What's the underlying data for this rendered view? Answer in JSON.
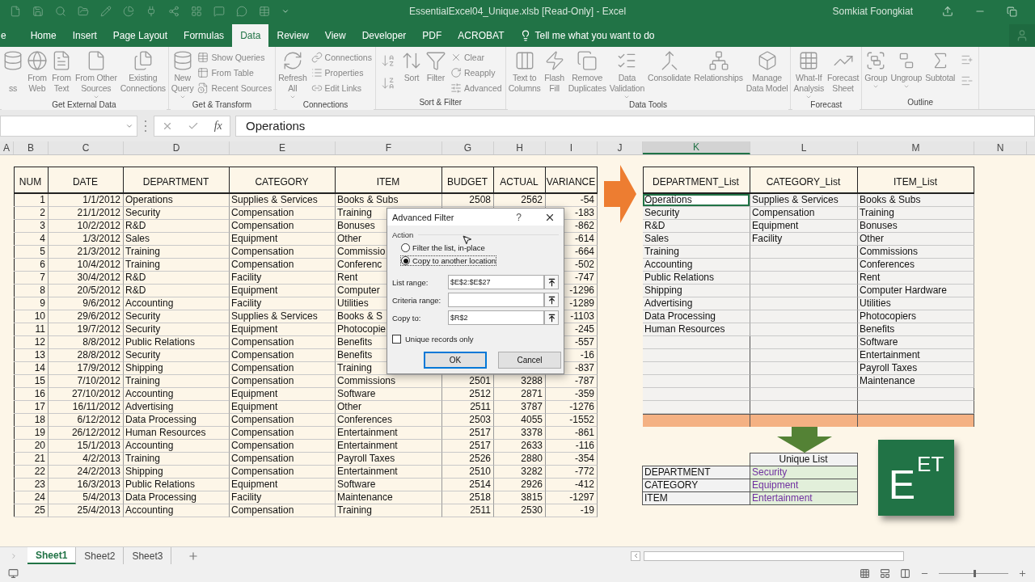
{
  "window": {
    "title": "EssentialExcel04_Unique.xlsb [Read-Only] - Excel",
    "user": "Somkiat Foongkiat"
  },
  "tabs": [
    {
      "label": "e",
      "selected": false
    },
    {
      "label": "Home",
      "selected": false
    },
    {
      "label": "Insert",
      "selected": false
    },
    {
      "label": "Page Layout",
      "selected": false
    },
    {
      "label": "Formulas",
      "selected": false
    },
    {
      "label": "Data",
      "selected": true
    },
    {
      "label": "Review",
      "selected": false
    },
    {
      "label": "View",
      "selected": false
    },
    {
      "label": "Developer",
      "selected": false
    },
    {
      "label": "PDF",
      "selected": false
    },
    {
      "label": "ACROBAT",
      "selected": false
    }
  ],
  "tell_me": "Tell me what you want to do",
  "ribbon": {
    "groups": [
      {
        "label": "Get External Data",
        "items": [
          {
            "kind": "large",
            "label": "\nss",
            "menu": false
          },
          {
            "kind": "large",
            "label": "From\nWeb",
            "menu": false
          },
          {
            "kind": "large",
            "label": "From\nText",
            "menu": false
          },
          {
            "kind": "large",
            "label": "From Other\nSources",
            "menu": true
          },
          {
            "kind": "large",
            "label": "Existing\nConnections",
            "menu": false
          }
        ]
      },
      {
        "label": "Get & Transform",
        "items": [
          {
            "kind": "large",
            "label": "New\nQuery",
            "menu": true
          },
          {
            "kind": "stack",
            "labels": [
              "Show Queries",
              "From Table",
              "Recent Sources"
            ]
          }
        ]
      },
      {
        "label": "Connections",
        "items": [
          {
            "kind": "large",
            "label": "Refresh\nAll",
            "menu": true
          },
          {
            "kind": "stack",
            "labels": [
              "Connections",
              "Properties",
              "Edit Links"
            ]
          }
        ]
      },
      {
        "label": "Sort & Filter",
        "items": [
          {
            "kind": "sort"
          },
          {
            "kind": "large",
            "label": "Sort",
            "menu": false
          },
          {
            "kind": "large",
            "label": "Filter",
            "menu": false
          },
          {
            "kind": "stack",
            "labels": [
              "Clear",
              "Reapply",
              "Advanced"
            ]
          }
        ]
      },
      {
        "label": "Data Tools",
        "items": [
          {
            "kind": "large",
            "label": "Text to\nColumns",
            "menu": false
          },
          {
            "kind": "large",
            "label": "Flash\nFill",
            "menu": false
          },
          {
            "kind": "large",
            "label": "Remove\nDuplicates",
            "menu": false
          },
          {
            "kind": "large",
            "label": "Data\nValidation",
            "menu": true
          },
          {
            "kind": "large",
            "label": "Consolidate",
            "menu": false
          },
          {
            "kind": "large",
            "label": "Relationships",
            "menu": false
          },
          {
            "kind": "large",
            "label": "Manage\nData Model",
            "menu": false
          }
        ]
      },
      {
        "label": "Forecast",
        "items": [
          {
            "kind": "large",
            "label": "What-If\nAnalysis",
            "menu": true
          },
          {
            "kind": "large",
            "label": "Forecast\nSheet",
            "menu": false
          }
        ]
      },
      {
        "label": "Outline",
        "items": [
          {
            "kind": "large",
            "label": "Group",
            "menu": true
          },
          {
            "kind": "large",
            "label": "Ungroup",
            "menu": true
          },
          {
            "kind": "large",
            "label": "Subtotal",
            "menu": false
          },
          {
            "kind": "outline-icons"
          }
        ]
      }
    ]
  },
  "formula_bar": {
    "function_label": "fx",
    "formula": "Operations"
  },
  "columns": [
    {
      "label": "A",
      "selected": false
    },
    {
      "label": "B",
      "selected": false
    },
    {
      "label": "C",
      "selected": false
    },
    {
      "label": "D",
      "selected": false
    },
    {
      "label": "E",
      "selected": false
    },
    {
      "label": "F",
      "selected": false
    },
    {
      "label": "G",
      "selected": false
    },
    {
      "label": "H",
      "selected": false
    },
    {
      "label": "I",
      "selected": false
    },
    {
      "label": "J",
      "selected": false
    },
    {
      "label": "K",
      "selected": true
    },
    {
      "label": "L",
      "selected": false
    },
    {
      "label": "M",
      "selected": false
    },
    {
      "label": "N",
      "selected": false
    }
  ],
  "data_table": {
    "headers": [
      "NUM",
      "DATE",
      "DEPARTMENT",
      "CATEGORY",
      "ITEM",
      "BUDGET",
      "ACTUAL",
      "VARIANCE"
    ],
    "rows": [
      [
        "1",
        "1/1/2012",
        "Operations",
        "Supplies & Services",
        "Books & Subs",
        "2508",
        "2562",
        "-54"
      ],
      [
        "2",
        "21/1/2012",
        "Security",
        "Compensation",
        "Training",
        null,
        null,
        "-183"
      ],
      [
        "3",
        "10/2/2012",
        "R&D",
        "Compensation",
        "Bonuses",
        null,
        null,
        "-862"
      ],
      [
        "4",
        "1/3/2012",
        "Sales",
        "Equipment",
        "Other",
        null,
        null,
        "-614"
      ],
      [
        "5",
        "21/3/2012",
        "Training",
        "Compensation",
        "Commissio",
        null,
        null,
        "-664"
      ],
      [
        "6",
        "10/4/2012",
        "Training",
        "Compensation",
        "Conferenc",
        null,
        null,
        "-502"
      ],
      [
        "7",
        "30/4/2012",
        "R&D",
        "Facility",
        "Rent",
        null,
        null,
        "-747"
      ],
      [
        "8",
        "20/5/2012",
        "R&D",
        "Equipment",
        "Computer",
        null,
        null,
        "-1296"
      ],
      [
        "9",
        "9/6/2012",
        "Accounting",
        "Facility",
        "Utilities",
        null,
        null,
        "-1289"
      ],
      [
        "10",
        "29/6/2012",
        "Security",
        "Supplies & Services",
        "Books & S",
        null,
        null,
        "-1103"
      ],
      [
        "11",
        "19/7/2012",
        "Security",
        "Equipment",
        "Photocopie",
        null,
        null,
        "-245"
      ],
      [
        "12",
        "8/8/2012",
        "Public Relations",
        "Compensation",
        "Benefits",
        null,
        null,
        "-557"
      ],
      [
        "13",
        "28/8/2012",
        "Security",
        "Compensation",
        "Benefits",
        null,
        null,
        "-16"
      ],
      [
        "14",
        "17/9/2012",
        "Shipping",
        "Compensation",
        "Training",
        null,
        null,
        "-837"
      ],
      [
        "15",
        "7/10/2012",
        "Training",
        "Compensation",
        "Commissions",
        "2501",
        "3288",
        "-787"
      ],
      [
        "16",
        "27/10/2012",
        "Accounting",
        "Equipment",
        "Software",
        "2512",
        "2871",
        "-359"
      ],
      [
        "17",
        "16/11/2012",
        "Advertising",
        "Equipment",
        "Other",
        "2511",
        "3787",
        "-1276"
      ],
      [
        "18",
        "6/12/2012",
        "Data Processing",
        "Compensation",
        "Conferences",
        "2503",
        "4055",
        "-1552"
      ],
      [
        "19",
        "26/12/2012",
        "Human Resources",
        "Compensation",
        "Entertainment",
        "2517",
        "3378",
        "-861"
      ],
      [
        "20",
        "15/1/2013",
        "Accounting",
        "Compensation",
        "Entertainment",
        "2517",
        "2633",
        "-116"
      ],
      [
        "21",
        "4/2/2013",
        "Training",
        "Compensation",
        "Payroll Taxes",
        "2526",
        "2880",
        "-354"
      ],
      [
        "22",
        "24/2/2013",
        "Shipping",
        "Compensation",
        "Entertainment",
        "2510",
        "3282",
        "-772"
      ],
      [
        "23",
        "16/3/2013",
        "Public Relations",
        "Equipment",
        "Software",
        "2514",
        "2926",
        "-412"
      ],
      [
        "24",
        "5/4/2013",
        "Data Processing",
        "Facility",
        "Maintenance",
        "2518",
        "3815",
        "-1297"
      ],
      [
        "25",
        "25/4/2013",
        "Accounting",
        "Compensation",
        "Training",
        "2511",
        "2530",
        "-19"
      ]
    ]
  },
  "lists": {
    "headers": [
      "DEPARTMENT_List",
      "CATEGORY_List",
      "ITEM_List"
    ],
    "rows": [
      {
        "cells": [
          "Operations",
          "Supplies & Services",
          "Books & Subs"
        ],
        "selected": true
      },
      {
        "cells": [
          "Security",
          "Compensation",
          "Training"
        ],
        "selected": false
      },
      {
        "cells": [
          "R&D",
          "Equipment",
          "Bonuses"
        ],
        "selected": false
      },
      {
        "cells": [
          "Sales",
          "Facility",
          "Other"
        ],
        "selected": false
      },
      {
        "cells": [
          "Training",
          null,
          "Commissions"
        ],
        "selected": false
      },
      {
        "cells": [
          "Accounting",
          null,
          "Conferences"
        ],
        "selected": false
      },
      {
        "cells": [
          "Public Relations",
          null,
          "Rent"
        ],
        "selected": false
      },
      {
        "cells": [
          "Shipping",
          null,
          "Computer Hardware"
        ],
        "selected": false
      },
      {
        "cells": [
          "Advertising",
          null,
          "Utilities"
        ],
        "selected": false
      },
      {
        "cells": [
          "Data Processing",
          null,
          "Photocopiers"
        ],
        "selected": false
      },
      {
        "cells": [
          "Human Resources",
          null,
          "Benefits"
        ],
        "selected": false
      },
      {
        "cells": [
          null,
          null,
          "Software"
        ],
        "selected": false
      },
      {
        "cells": [
          null,
          null,
          "Entertainment"
        ],
        "selected": false
      },
      {
        "cells": [
          null,
          null,
          "Payroll Taxes"
        ],
        "selected": false
      },
      {
        "cells": [
          null,
          null,
          "Maintenance"
        ],
        "selected": false
      },
      {
        "cells": [
          null,
          null,
          null
        ],
        "selected": false
      },
      {
        "cells": [
          null,
          null,
          null
        ],
        "selected": false
      }
    ]
  },
  "unique_list": {
    "header": "Unique List",
    "rows": [
      {
        "label": "DEPARTMENT",
        "value": "Security"
      },
      {
        "label": "CATEGORY",
        "value": "Equipment"
      },
      {
        "label": "ITEM",
        "value": "Entertainment"
      }
    ]
  },
  "logo": {
    "letter": "E",
    "superscript": "ET"
  },
  "dialog": {
    "title": "Advanced Filter",
    "help": "?",
    "section": "Action",
    "options": [
      {
        "label": "Filter the list, in-place",
        "selected": false
      },
      {
        "label": "Copy to another location",
        "selected": true
      }
    ],
    "fields": [
      {
        "label": "List range:",
        "value": "$E$2:$E$27"
      },
      {
        "label": "Criteria range:"
      },
      {
        "label": "Copy to:",
        "value": "$R$2"
      }
    ],
    "checkbox": {
      "label": "Unique records only",
      "checked": false
    },
    "buttons": [
      {
        "label": "OK",
        "default": true
      },
      {
        "label": "Cancel",
        "default": false
      }
    ]
  },
  "sheet_tabs": [
    {
      "label": "Sheet1",
      "selected": true
    },
    {
      "label": "Sheet2",
      "selected": false
    },
    {
      "label": "Sheet3",
      "selected": false
    }
  ],
  "zoom": {
    "level": 0.5
  }
}
